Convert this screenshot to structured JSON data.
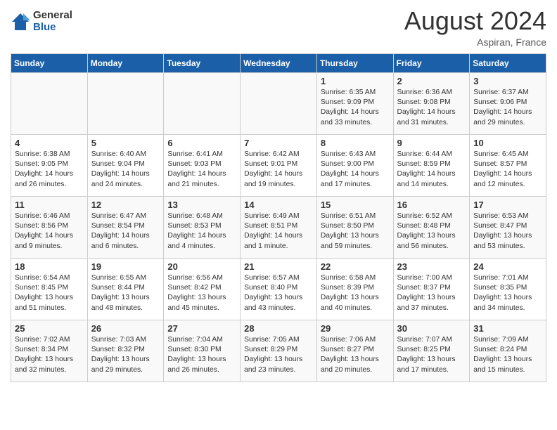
{
  "header": {
    "logo_general": "General",
    "logo_blue": "Blue",
    "month_year": "August 2024",
    "location": "Aspiran, France"
  },
  "days_of_week": [
    "Sunday",
    "Monday",
    "Tuesday",
    "Wednesday",
    "Thursday",
    "Friday",
    "Saturday"
  ],
  "weeks": [
    [
      {
        "day": "",
        "info": ""
      },
      {
        "day": "",
        "info": ""
      },
      {
        "day": "",
        "info": ""
      },
      {
        "day": "",
        "info": ""
      },
      {
        "day": "1",
        "info": "Sunrise: 6:35 AM\nSunset: 9:09 PM\nDaylight: 14 hours\nand 33 minutes."
      },
      {
        "day": "2",
        "info": "Sunrise: 6:36 AM\nSunset: 9:08 PM\nDaylight: 14 hours\nand 31 minutes."
      },
      {
        "day": "3",
        "info": "Sunrise: 6:37 AM\nSunset: 9:06 PM\nDaylight: 14 hours\nand 29 minutes."
      }
    ],
    [
      {
        "day": "4",
        "info": "Sunrise: 6:38 AM\nSunset: 9:05 PM\nDaylight: 14 hours\nand 26 minutes."
      },
      {
        "day": "5",
        "info": "Sunrise: 6:40 AM\nSunset: 9:04 PM\nDaylight: 14 hours\nand 24 minutes."
      },
      {
        "day": "6",
        "info": "Sunrise: 6:41 AM\nSunset: 9:03 PM\nDaylight: 14 hours\nand 21 minutes."
      },
      {
        "day": "7",
        "info": "Sunrise: 6:42 AM\nSunset: 9:01 PM\nDaylight: 14 hours\nand 19 minutes."
      },
      {
        "day": "8",
        "info": "Sunrise: 6:43 AM\nSunset: 9:00 PM\nDaylight: 14 hours\nand 17 minutes."
      },
      {
        "day": "9",
        "info": "Sunrise: 6:44 AM\nSunset: 8:59 PM\nDaylight: 14 hours\nand 14 minutes."
      },
      {
        "day": "10",
        "info": "Sunrise: 6:45 AM\nSunset: 8:57 PM\nDaylight: 14 hours\nand 12 minutes."
      }
    ],
    [
      {
        "day": "11",
        "info": "Sunrise: 6:46 AM\nSunset: 8:56 PM\nDaylight: 14 hours\nand 9 minutes."
      },
      {
        "day": "12",
        "info": "Sunrise: 6:47 AM\nSunset: 8:54 PM\nDaylight: 14 hours\nand 6 minutes."
      },
      {
        "day": "13",
        "info": "Sunrise: 6:48 AM\nSunset: 8:53 PM\nDaylight: 14 hours\nand 4 minutes."
      },
      {
        "day": "14",
        "info": "Sunrise: 6:49 AM\nSunset: 8:51 PM\nDaylight: 14 hours\nand 1 minute."
      },
      {
        "day": "15",
        "info": "Sunrise: 6:51 AM\nSunset: 8:50 PM\nDaylight: 13 hours\nand 59 minutes."
      },
      {
        "day": "16",
        "info": "Sunrise: 6:52 AM\nSunset: 8:48 PM\nDaylight: 13 hours\nand 56 minutes."
      },
      {
        "day": "17",
        "info": "Sunrise: 6:53 AM\nSunset: 8:47 PM\nDaylight: 13 hours\nand 53 minutes."
      }
    ],
    [
      {
        "day": "18",
        "info": "Sunrise: 6:54 AM\nSunset: 8:45 PM\nDaylight: 13 hours\nand 51 minutes."
      },
      {
        "day": "19",
        "info": "Sunrise: 6:55 AM\nSunset: 8:44 PM\nDaylight: 13 hours\nand 48 minutes."
      },
      {
        "day": "20",
        "info": "Sunrise: 6:56 AM\nSunset: 8:42 PM\nDaylight: 13 hours\nand 45 minutes."
      },
      {
        "day": "21",
        "info": "Sunrise: 6:57 AM\nSunset: 8:40 PM\nDaylight: 13 hours\nand 43 minutes."
      },
      {
        "day": "22",
        "info": "Sunrise: 6:58 AM\nSunset: 8:39 PM\nDaylight: 13 hours\nand 40 minutes."
      },
      {
        "day": "23",
        "info": "Sunrise: 7:00 AM\nSunset: 8:37 PM\nDaylight: 13 hours\nand 37 minutes."
      },
      {
        "day": "24",
        "info": "Sunrise: 7:01 AM\nSunset: 8:35 PM\nDaylight: 13 hours\nand 34 minutes."
      }
    ],
    [
      {
        "day": "25",
        "info": "Sunrise: 7:02 AM\nSunset: 8:34 PM\nDaylight: 13 hours\nand 32 minutes."
      },
      {
        "day": "26",
        "info": "Sunrise: 7:03 AM\nSunset: 8:32 PM\nDaylight: 13 hours\nand 29 minutes."
      },
      {
        "day": "27",
        "info": "Sunrise: 7:04 AM\nSunset: 8:30 PM\nDaylight: 13 hours\nand 26 minutes."
      },
      {
        "day": "28",
        "info": "Sunrise: 7:05 AM\nSunset: 8:29 PM\nDaylight: 13 hours\nand 23 minutes."
      },
      {
        "day": "29",
        "info": "Sunrise: 7:06 AM\nSunset: 8:27 PM\nDaylight: 13 hours\nand 20 minutes."
      },
      {
        "day": "30",
        "info": "Sunrise: 7:07 AM\nSunset: 8:25 PM\nDaylight: 13 hours\nand 17 minutes."
      },
      {
        "day": "31",
        "info": "Sunrise: 7:09 AM\nSunset: 8:24 PM\nDaylight: 13 hours\nand 15 minutes."
      }
    ]
  ]
}
